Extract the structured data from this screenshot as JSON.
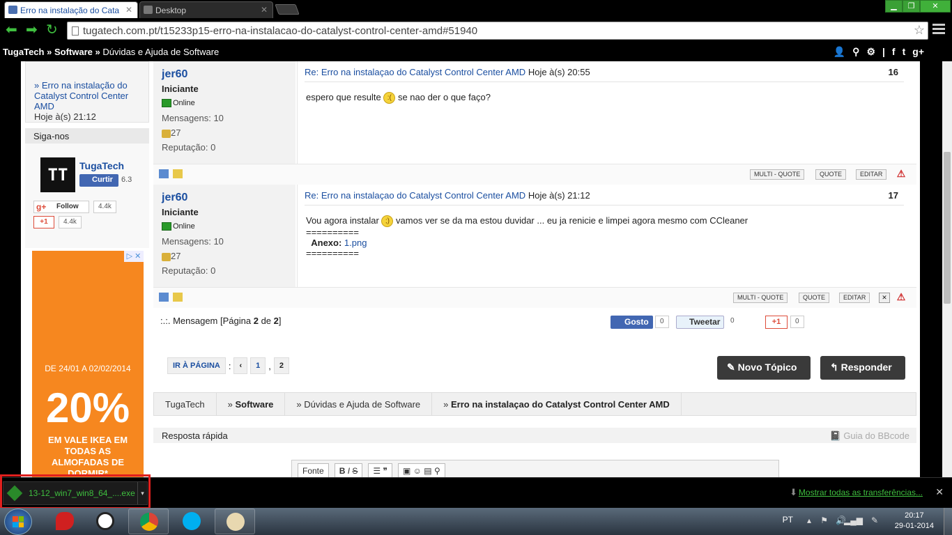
{
  "browser": {
    "tabs": [
      {
        "label": "Erro na instalação do Cata",
        "active": true
      },
      {
        "label": "Desktop",
        "active": false
      }
    ],
    "url": "tugatech.com.pt/t15233p15-erro-na-instalacao-do-catalyst-control-center-amd#51940"
  },
  "sitebar": {
    "home": "TugaTech",
    "sep": "»",
    "section": "Software",
    "subsection": "Dúvidas e Ajuda de Software"
  },
  "sidebar": {
    "recent_link": "» Erro na instalação do Catalyst Control Center AMD",
    "recent_meta": "Hoje à(s) 21:12",
    "follow_title": "Siga-nos",
    "brand": "TugaTech",
    "fb_like": "Curtir",
    "fb_count": "6.3",
    "gp_follow": "Follow",
    "gp_follow_count": "4.4k",
    "gp_plus": "+1",
    "gp_plus_count": "4.4k",
    "ad": {
      "badge": "▷ ✕",
      "dates": "DE 24/01 A 02/02/2014",
      "percent": "20%",
      "promo": "EM VALE IKEA EM TODAS AS ALMOFADAS DE DORMIR*"
    }
  },
  "posts": [
    {
      "username": "jer60",
      "rank": "Iniciante",
      "status": "Online",
      "messages_label": "Mensagens:",
      "messages": "10",
      "coins": "27",
      "rep_label": "Reputação:",
      "rep": "0",
      "title": "Re: Erro na instalaçao do Catalyst Control Center AMD",
      "time": "Hoje à(s) 20:55",
      "number": "16",
      "text_before": "espero que resulte",
      "text_after": "se nao der o que faço?",
      "multi_quote": "MULTI - QUOTE",
      "quote": "QUOTE",
      "edit": "EDITAR"
    },
    {
      "username": "jer60",
      "rank": "Iniciante",
      "status": "Online",
      "messages_label": "Mensagens:",
      "messages": "10",
      "coins": "27",
      "rep_label": "Reputação:",
      "rep": "0",
      "title": "Re: Erro na instalaçao do Catalyst Control Center AMD",
      "time": "Hoje à(s) 21:12",
      "number": "17",
      "text_before": "Vou agora instalar",
      "text_after": "vamos ver se da ma estou duvidar ... eu ja renicie e limpei agora mesmo com CCleaner",
      "sep1": "==========",
      "attach_label": "Anexo:",
      "attach_file": "1.png",
      "sep2": "==========",
      "multi_quote": "MULTI - QUOTE",
      "quote": "QUOTE",
      "edit": "EDITAR"
    }
  ],
  "summary": {
    "prefix": ":.:.",
    "text": "Mensagem [Página",
    "page": "2",
    "of": "de",
    "total": "2",
    "close": "]",
    "fb_like": "Gosto",
    "fb_count": "0",
    "tweet": "Tweetar",
    "tweet_count": "0",
    "gplus": "+1",
    "gplus_count": "0"
  },
  "pager": {
    "goto": "IR À PÁGINA",
    "colon": ":",
    "prev": "‹",
    "p1": "1",
    "comma": ",",
    "p2": "2"
  },
  "buttons": {
    "new_topic": "Novo Tópico",
    "reply": "Responder"
  },
  "breadcrumbs": [
    "TugaTech",
    "Software",
    "Dúvidas e Ajuda de Software",
    "Erro na instalaçao do Catalyst Control Center AMD"
  ],
  "quick_reply": {
    "title": "Resposta rápida",
    "bbcode": "Guia do BBcode",
    "font": "Fonte",
    "bold": "B",
    "italic": "I",
    "strike": "S"
  },
  "downloads": {
    "file": "13-12_win7_win8_64_....exe",
    "show_all": "Mostrar todas as transferências..."
  },
  "taskbar": {
    "lang": "PT",
    "time": "20:17",
    "date": "29-01-2014"
  },
  "colors": {
    "link": "#1a4ea0",
    "accent_green": "#3fbf3f",
    "highlight_red": "#e0201e",
    "ad_orange": "#f6871f"
  }
}
